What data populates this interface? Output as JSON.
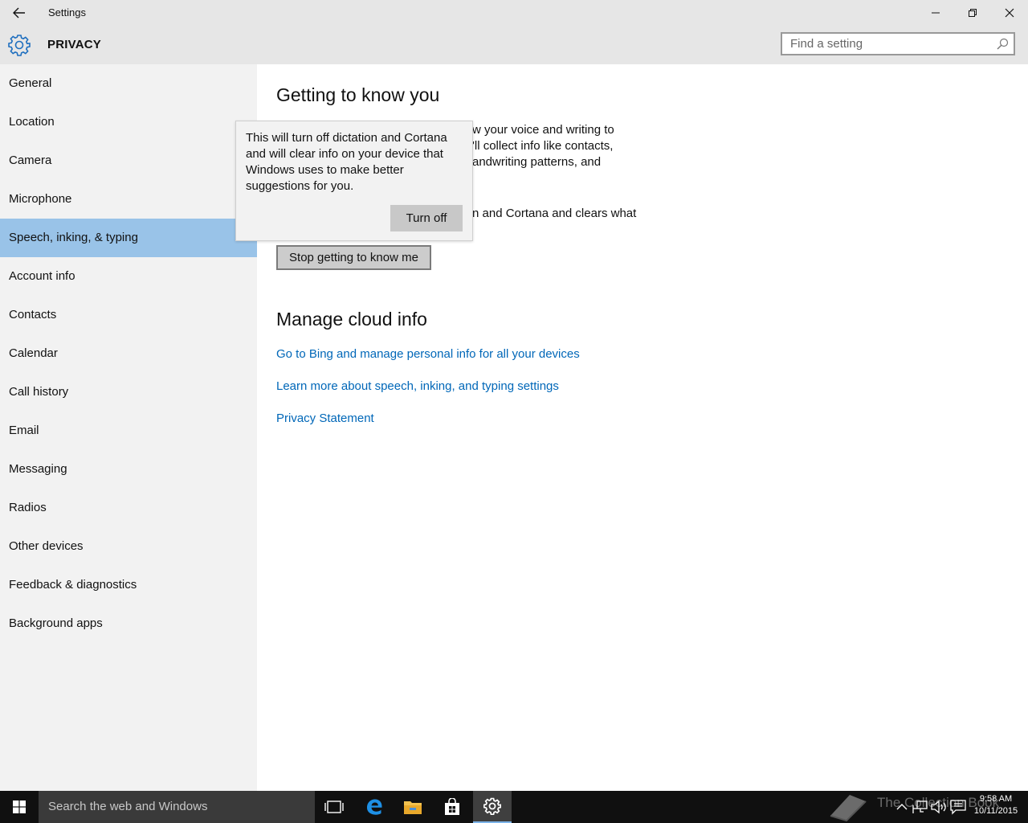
{
  "window": {
    "title": "Settings"
  },
  "header": {
    "heading": "PRIVACY",
    "search_placeholder": "Find a setting"
  },
  "sidebar": {
    "items": [
      {
        "label": "General"
      },
      {
        "label": "Location"
      },
      {
        "label": "Camera"
      },
      {
        "label": "Microphone"
      },
      {
        "label": "Speech, inking, & typing",
        "active": true
      },
      {
        "label": "Account info"
      },
      {
        "label": "Contacts"
      },
      {
        "label": "Calendar"
      },
      {
        "label": "Call history"
      },
      {
        "label": "Email"
      },
      {
        "label": "Messaging"
      },
      {
        "label": "Radios"
      },
      {
        "label": "Other devices"
      },
      {
        "label": "Feedback & diagnostics"
      },
      {
        "label": "Background apps"
      }
    ]
  },
  "main": {
    "section1_title": "Getting to know you",
    "para1_lines": [
      "w your voice and writing to",
      "'ll collect info like contacts,",
      "andwriting patterns, and"
    ],
    "para2_line": "n and Cortana and clears what",
    "stop_button": "Stop getting to know me",
    "section2_title": "Manage cloud info",
    "links": [
      "Go to Bing and manage personal info for all your devices",
      "Learn more about speech, inking, and typing settings",
      "Privacy Statement"
    ]
  },
  "flyout": {
    "message": "This will turn off dictation and Cortana and will clear info on your device that Windows uses to make better suggestions for you.",
    "button": "Turn off"
  },
  "taskbar": {
    "search_placeholder": "Search the web and Windows",
    "watermark": "The Collection Book",
    "time": "9:58 AM",
    "date": "10/11/2015"
  },
  "colors": {
    "accent": "#0067b8",
    "nav_active": "#99c3e8",
    "link": "#0067b8"
  }
}
